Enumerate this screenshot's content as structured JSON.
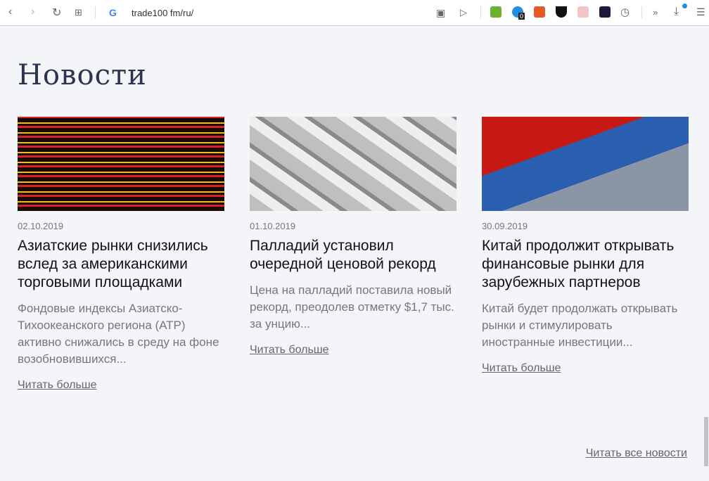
{
  "browser": {
    "url": "trade100 fm/ru/",
    "badge": "0"
  },
  "page": {
    "title": "Новости",
    "all_news": "Читать все новости"
  },
  "cards": [
    {
      "date": "02.10.2019",
      "title": "Азиатские рынки снизились вслед за американскими торговыми площадками",
      "desc": "Фондовые индексы Азиатско-Тихоокеанского региона (АТР) активно снижались в среду на фоне возобновившихся...",
      "more": "Читать больше"
    },
    {
      "date": "01.10.2019",
      "title": "Палладий установил очередной ценовой рекорд",
      "desc": "Цена на палладий поставила новый рекорд, преодолев отметку $1,7 тыс. за унцию...",
      "more": "Читать больше"
    },
    {
      "date": "30.09.2019",
      "title": "Китай продолжит открывать финансовые рынки для зарубежных партнеров",
      "desc": "Китай будет продолжать открывать рынки и стимулировать иностранные инвестиции...",
      "more": "Читать больше"
    }
  ]
}
